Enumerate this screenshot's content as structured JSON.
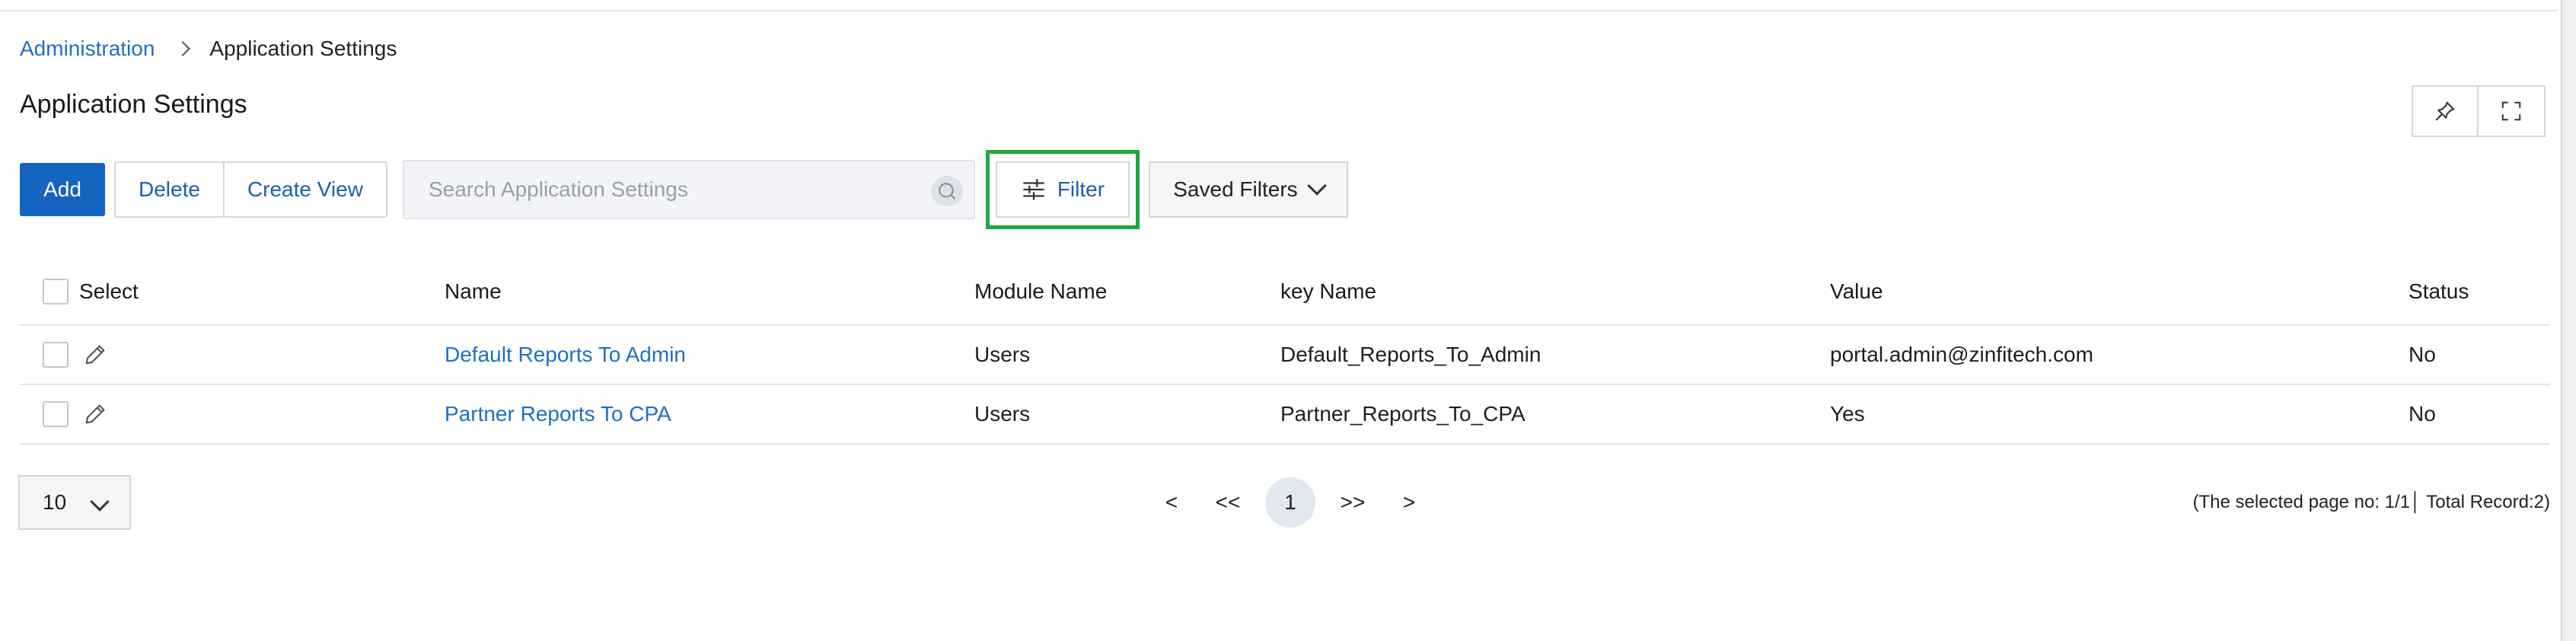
{
  "breadcrumb": {
    "root": "Administration",
    "current": "Application Settings"
  },
  "page": {
    "title": "Application Settings"
  },
  "toolbar": {
    "add": "Add",
    "delete": "Delete",
    "create_view": "Create View",
    "search_placeholder": "Search Application Settings",
    "filter": "Filter",
    "saved_filters": "Saved Filters"
  },
  "table": {
    "headers": {
      "select": "Select",
      "name": "Name",
      "module": "Module Name",
      "key": "key Name",
      "value": "Value",
      "status": "Status"
    },
    "rows": [
      {
        "name": "Default Reports To Admin",
        "module": "Users",
        "key": "Default_Reports_To_Admin",
        "value": "portal.admin@zinfitech.com",
        "status": "No"
      },
      {
        "name": "Partner Reports To CPA",
        "module": "Users",
        "key": "Partner_Reports_To_CPA",
        "value": "Yes",
        "status": "No"
      }
    ]
  },
  "pagination": {
    "page_size": "10",
    "prev": "<",
    "first": "<<",
    "current": "1",
    "last": ">>",
    "next": ">",
    "record_info": "(The selected page no: 1/1│ Total Record:2)"
  },
  "colors": {
    "primary": "#1565c0",
    "link": "#1f6fc5",
    "highlight": "#1fa83b"
  },
  "icons": {
    "pin": "pin-icon",
    "fullscreen": "fullscreen-icon",
    "search": "search-icon",
    "filter": "sliders-icon",
    "edit": "pencil-icon"
  }
}
